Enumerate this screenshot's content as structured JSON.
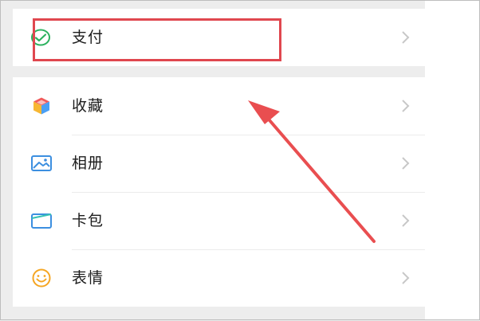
{
  "menu": {
    "items": [
      {
        "label": "支付",
        "icon": "wechat-pay-icon"
      },
      {
        "label": "收藏",
        "icon": "favorites-cube-icon"
      },
      {
        "label": "相册",
        "icon": "photo-album-icon"
      },
      {
        "label": "卡包",
        "icon": "card-wallet-icon"
      },
      {
        "label": "表情",
        "icon": "emoji-smile-icon"
      }
    ]
  },
  "annotation": {
    "highlight_color": "#e0474f",
    "arrow_color": "#e94e50"
  }
}
